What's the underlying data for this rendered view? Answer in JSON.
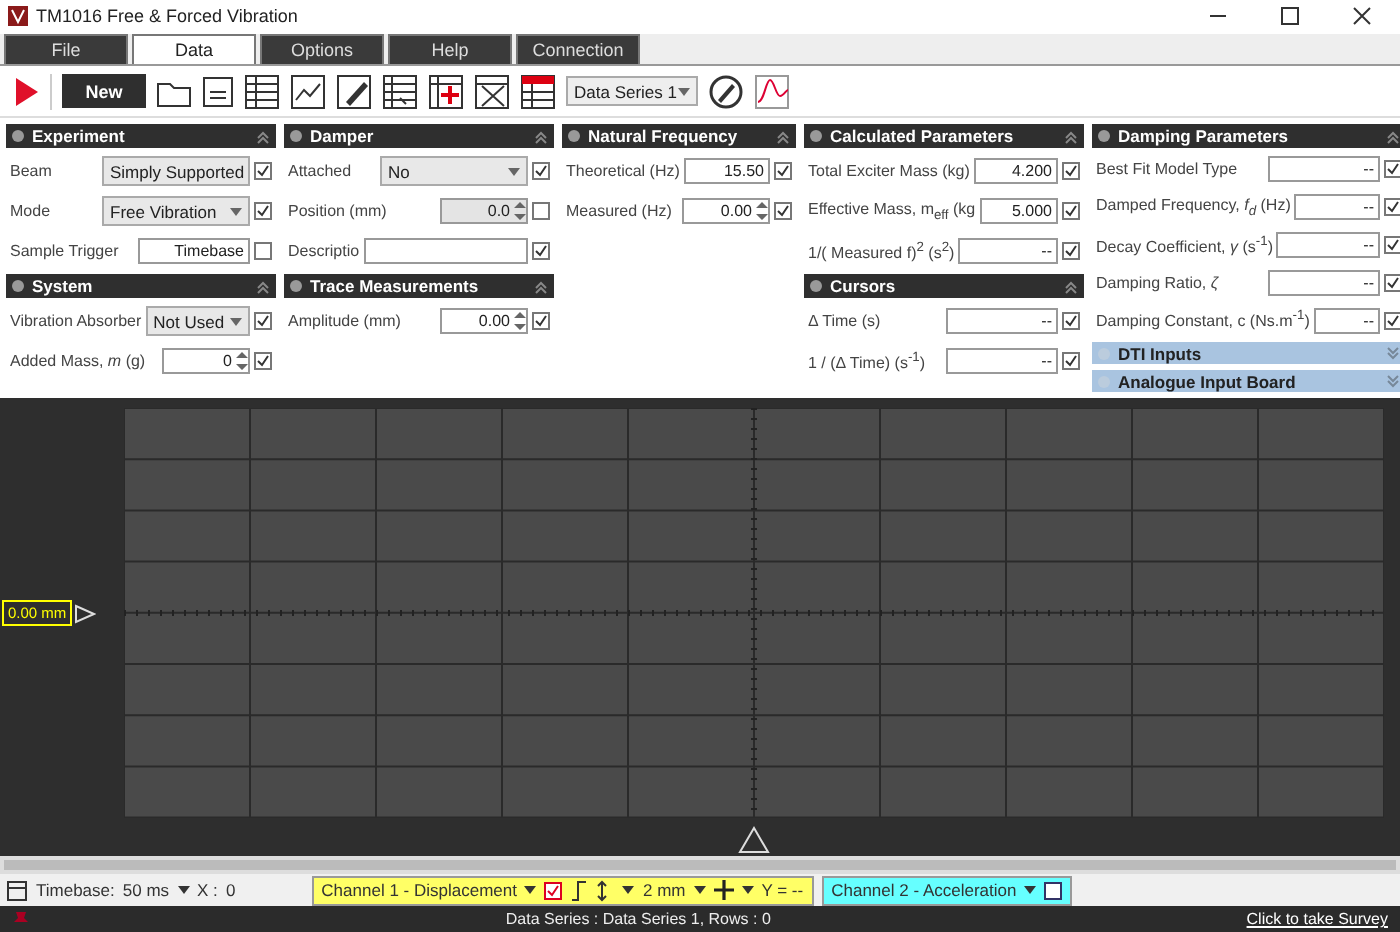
{
  "window": {
    "title": "TM1016 Free & Forced Vibration"
  },
  "tabs": [
    {
      "label": "File",
      "selected": false
    },
    {
      "label": "Data",
      "selected": true
    },
    {
      "label": "Options",
      "selected": false
    },
    {
      "label": "Help",
      "selected": false
    },
    {
      "label": "Connection",
      "selected": false
    }
  ],
  "toolbar": {
    "new_button": "New",
    "data_series": "Data Series 1"
  },
  "panel_columns": [
    [
      {
        "title": "Experiment",
        "expanded": true,
        "rows": [
          {
            "kind": "select",
            "label": "Beam",
            "value": "Simply Supported",
            "checked": true
          },
          {
            "kind": "select",
            "label": "Mode",
            "value": "Free Vibration",
            "checked": true
          },
          {
            "kind": "field",
            "label": "Sample Trigger",
            "value": "Timebase",
            "checked": false
          }
        ]
      },
      {
        "title": "System",
        "expanded": true,
        "rows": [
          {
            "kind": "select",
            "label": "Vibration Absorber",
            "value": "Not Used",
            "checked": true
          },
          {
            "kind": "spinner",
            "label": "Added Mass, *m*  (g)",
            "value": "0",
            "checked": true
          }
        ]
      }
    ],
    [
      {
        "title": "Damper",
        "expanded": true,
        "rows": [
          {
            "kind": "select",
            "label": "Attached",
            "value": "No",
            "checked": true
          },
          {
            "kind": "spinner",
            "label": "Position  (mm)",
            "value": "0.0",
            "checked": false,
            "disabled": true
          },
          {
            "kind": "field",
            "label": "Descriptio",
            "checked": true
          }
        ]
      },
      {
        "title": "Trace Measurements",
        "expanded": true,
        "rows": [
          {
            "kind": "spinner",
            "label": "Amplitude  (mm)",
            "value": "0.00",
            "checked": true
          }
        ]
      }
    ],
    [
      {
        "title": "Natural Frequency",
        "expanded": true,
        "rows": [
          {
            "kind": "field",
            "label": "Theoretical (Hz)",
            "value": "15.50",
            "checked": true
          },
          {
            "kind": "spinner",
            "label": "Measured (Hz)",
            "value": "0.00",
            "checked": true
          }
        ]
      }
    ],
    [
      {
        "title": "Calculated Parameters",
        "expanded": true,
        "rows": [
          {
            "kind": "field",
            "label": "Total Exciter Mass  (kg)",
            "value": "4.200",
            "checked": true
          },
          {
            "kind": "field",
            "label": "Effective Mass, m$_{eff}$ (kg",
            "value": "5.000",
            "checked": true
          },
          {
            "kind": "field",
            "label": "1/( Measured f)$^{2}$ (s$^{2}$)",
            "value": "--",
            "checked": true
          }
        ]
      },
      {
        "title": "Cursors",
        "expanded": true,
        "rows": [
          {
            "kind": "field",
            "label": "Δ Time  (s)",
            "value": "--",
            "checked": true
          },
          {
            "kind": "field",
            "label": "1 / (Δ Time) (s$^{-1}$)",
            "value": "--",
            "checked": true
          }
        ]
      }
    ],
    [
      {
        "title": "Damping Parameters",
        "expanded": true,
        "rows": [
          {
            "kind": "field",
            "label": "Best Fit Model Type",
            "value": "--",
            "checked": true
          },
          {
            "kind": "field",
            "label": "Damped Frequency, *f$_{d}$* (Hz)",
            "value": "--",
            "checked": true
          },
          {
            "kind": "field",
            "label": "Decay Coefficient, *γ* (s$^{-1}$)",
            "value": "--",
            "checked": true
          },
          {
            "kind": "field",
            "label": "Damping Ratio, *ζ*",
            "value": "--",
            "checked": true
          },
          {
            "kind": "field",
            "label": "Damping Constant, c (Ns.m$^{-1}$)",
            "value": "--",
            "checked": true
          }
        ]
      },
      {
        "title": "DTI Inputs",
        "expanded": false
      },
      {
        "title": "Analogue Input Board",
        "expanded": false
      }
    ]
  ],
  "scope": {
    "offset_label": "0.00 mm"
  },
  "bottom_bar": {
    "timebase_label": "Timebase:",
    "timebase": "50 ms",
    "x_label": "X :",
    "x_value": "0",
    "channels": [
      {
        "name": "Channel 1 - Displacement",
        "color": "#ffff66",
        "checked": true,
        "scale": "2 mm",
        "y_readout": "Y = --"
      },
      {
        "name": "Channel 2 - Acceleration",
        "color": "#66ffff",
        "checked": false
      }
    ]
  },
  "status_bar": {
    "text": "Data Series : Data Series 1,  Rows : 0",
    "link": "Click to take Survey"
  }
}
